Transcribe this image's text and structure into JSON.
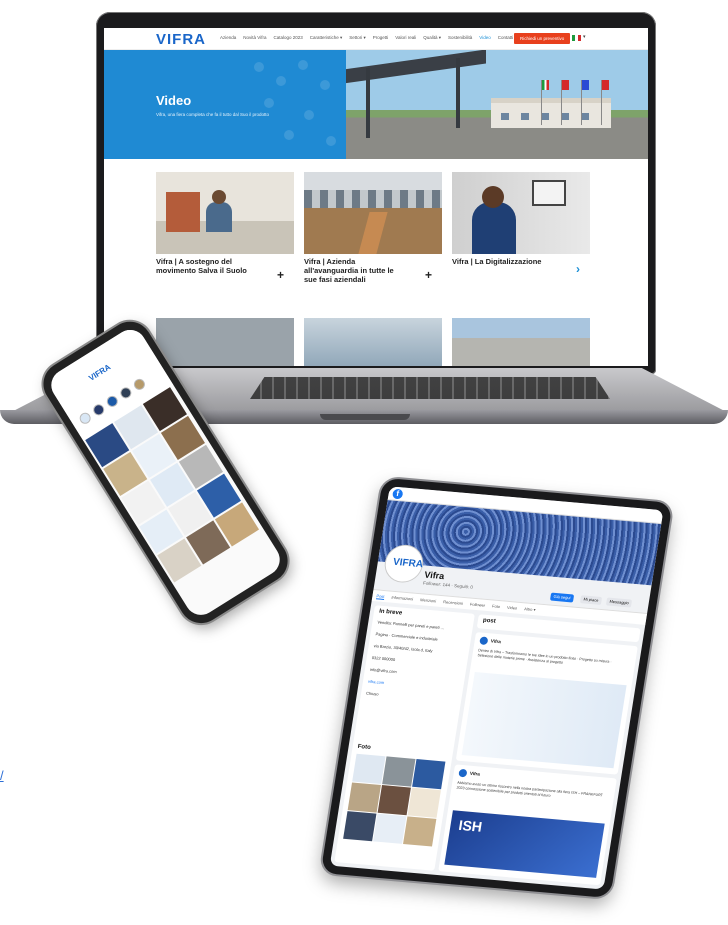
{
  "site": {
    "logo": "VIFRA",
    "menu": [
      "Azienda",
      "Novità Vifra",
      "Catalogo 2023",
      "Caratteristiche ▾",
      "Settori ▾",
      "Progetti",
      "Valori reali",
      "Qualità ▾",
      "Sostenibilità",
      "Video",
      "Contatti"
    ],
    "active_menu": "Video",
    "cta": "Richiedi un preventivo",
    "lang_caret": "▾"
  },
  "hero": {
    "title": "Video",
    "subtitle": "Vifra, una fiera completa che fa il tutto dal Suo il prodotto"
  },
  "video_cards": [
    {
      "title": "Vifra | A sostegno del movimento Salva il Suolo",
      "action": "+"
    },
    {
      "title": "Vifra | Azienda all'avanguardia in tutte le sue fasi aziendali",
      "action": "+"
    },
    {
      "title": "Vifra | La Digitalizzazione",
      "action": "›"
    }
  ],
  "instagram": {
    "logo": "VIFRA"
  },
  "facebook": {
    "logo_letter": "f",
    "page_name": "Vifra",
    "avatar_text": "VIFRA",
    "followers": "Follower: 144 · Seguiti: 0",
    "tabs": [
      "Post",
      "Informazioni",
      "Menzioni",
      "Recensioni",
      "Follower",
      "Foto",
      "Video",
      "Altro ▾"
    ],
    "active_tab": "Post",
    "btn_follow": "Già segui",
    "btn_message": "Messaggio",
    "btn_save": "Mi piace",
    "intro_title": "In breve",
    "info": [
      "Vendita: Pannelli per pareti e pareti ...",
      "Pagina · Commerciale e industriale",
      "via Barzio, 30/40/42, Isola d, Italy",
      "0322 000000",
      "info@vifra.com",
      "vifra.com",
      "Chiuso"
    ],
    "photos_title": "Foto",
    "posts_title": "post",
    "post1_name": "Vifra",
    "post1_text": "Dentro di Vifra – Trasformiamo le tue idee in un prodotto finito · Progetto su misura · Selezione delle materie prime · Assistenza al progetto",
    "post2_name": "Vifra",
    "post2_text": "Abbiamo avuto un ottimo riscontro nella nostra partecipazione alla fiera ISH – FRANKFURT 2023 connessione sostenibile per prodotti orientati al futuro",
    "ish": "ISH"
  },
  "link_text": "/"
}
